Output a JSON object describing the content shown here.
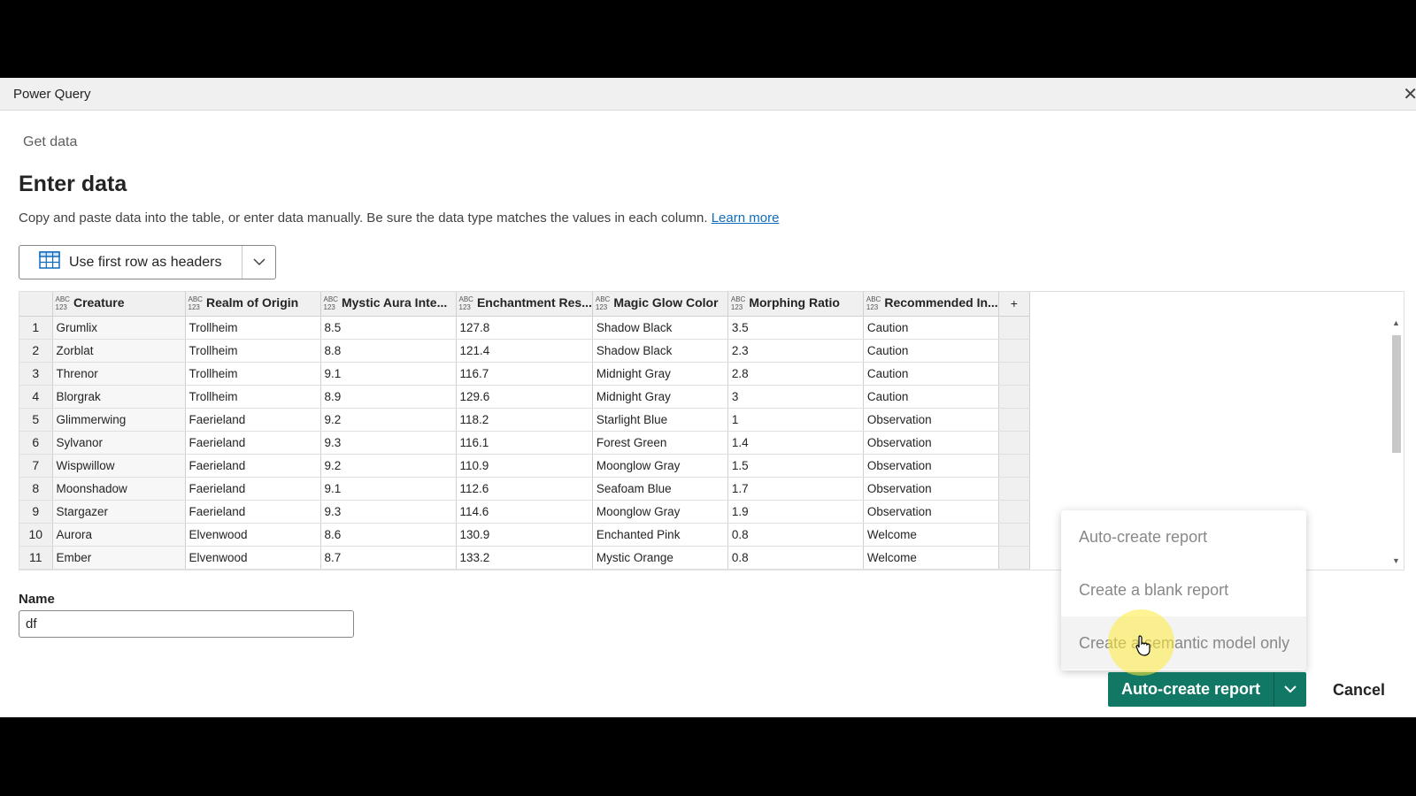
{
  "window": {
    "title": "Power Query"
  },
  "breadcrumb": "Get data",
  "heading": "Enter data",
  "description": "Copy and paste data into the table, or enter data manually. Be sure the data type matches the values in each column.",
  "learn_more": "Learn more",
  "headers_button": {
    "label": "Use first row as headers",
    "icon": "table-icon"
  },
  "type_icon": {
    "top": "ABC",
    "bottom": "123"
  },
  "table": {
    "add_column": "+",
    "columns": [
      "Creature",
      "Realm of Origin",
      "Mystic Aura Inte...",
      "Enchantment Res...",
      "Magic Glow Color",
      "Morphing Ratio",
      "Recommended In..."
    ],
    "rows": [
      [
        "1",
        "Grumlix",
        "Trollheim",
        "8.5",
        "127.8",
        "Shadow Black",
        "3.5",
        "Caution"
      ],
      [
        "2",
        "Zorblat",
        "Trollheim",
        "8.8",
        "121.4",
        "Shadow Black",
        "2.3",
        "Caution"
      ],
      [
        "3",
        "Threnor",
        "Trollheim",
        "9.1",
        "116.7",
        "Midnight Gray",
        "2.8",
        "Caution"
      ],
      [
        "4",
        "Blorgrak",
        "Trollheim",
        "8.9",
        "129.6",
        "Midnight Gray",
        "3",
        "Caution"
      ],
      [
        "5",
        "Glimmerwing",
        "Faerieland",
        "9.2",
        "118.2",
        "Starlight Blue",
        "1",
        "Observation"
      ],
      [
        "6",
        "Sylvanor",
        "Faerieland",
        "9.3",
        "116.1",
        "Forest Green",
        "1.4",
        "Observation"
      ],
      [
        "7",
        "Wispwillow",
        "Faerieland",
        "9.2",
        "110.9",
        "Moonglow Gray",
        "1.5",
        "Observation"
      ],
      [
        "8",
        "Moonshadow",
        "Faerieland",
        "9.1",
        "112.6",
        "Seafoam Blue",
        "1.7",
        "Observation"
      ],
      [
        "9",
        "Stargazer",
        "Faerieland",
        "9.3",
        "114.6",
        "Moonglow Gray",
        "1.9",
        "Observation"
      ],
      [
        "10",
        "Aurora",
        "Elvenwood",
        "8.6",
        "130.9",
        "Enchanted Pink",
        "0.8",
        "Welcome"
      ],
      [
        "11",
        "Ember",
        "Elvenwood",
        "8.7",
        "133.2",
        "Mystic Orange",
        "0.8",
        "Welcome"
      ]
    ]
  },
  "name_field": {
    "label": "Name",
    "value": "df"
  },
  "dropdown_menu": {
    "items": [
      "Auto-create report",
      "Create a blank report",
      "Create a semantic model only"
    ]
  },
  "primary_button": {
    "label": "Auto-create report",
    "color": "#117865"
  },
  "cancel_button": {
    "label": "Cancel"
  }
}
